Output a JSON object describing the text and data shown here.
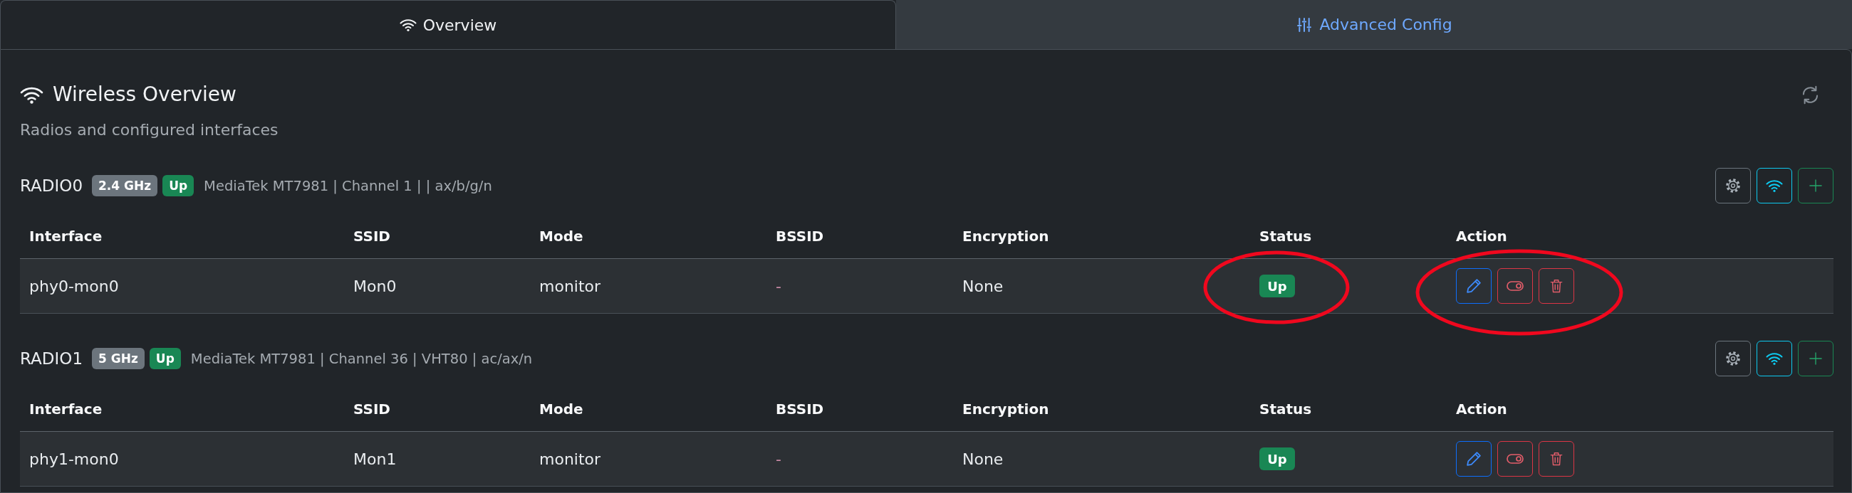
{
  "tabs": [
    {
      "label": "Overview",
      "selected": true
    },
    {
      "label": "Advanced Config",
      "selected": false
    }
  ],
  "overview": {
    "title": "Wireless Overview",
    "subtitle": "Radios and configured interfaces"
  },
  "radios": [
    {
      "name": "RADIO0",
      "band": "2.4 GHz",
      "state": "Up",
      "details": "MediaTek MT7981 | Channel 1 | | ax/b/g/n",
      "table": {
        "columns": [
          "Interface",
          "SSID",
          "Mode",
          "BSSID",
          "Encryption",
          "Status",
          "Action"
        ],
        "rows": [
          {
            "interface": "phy0-mon0",
            "ssid": "Mon0",
            "mode": "monitor",
            "bssid": "-",
            "encryption": "None",
            "status": "Up",
            "status_circled": true,
            "actions_circled": true
          }
        ]
      }
    },
    {
      "name": "RADIO1",
      "band": "5 GHz",
      "state": "Up",
      "details": "MediaTek MT7981 | Channel 36 | VHT80 | ac/ax/n",
      "table": {
        "columns": [
          "Interface",
          "SSID",
          "Mode",
          "BSSID",
          "Encryption",
          "Status",
          "Action"
        ],
        "rows": [
          {
            "interface": "phy1-mon0",
            "ssid": "Mon1",
            "mode": "monitor",
            "bssid": "-",
            "encryption": "None",
            "status": "Up",
            "status_circled": false,
            "actions_circled": false
          }
        ]
      }
    }
  ]
}
